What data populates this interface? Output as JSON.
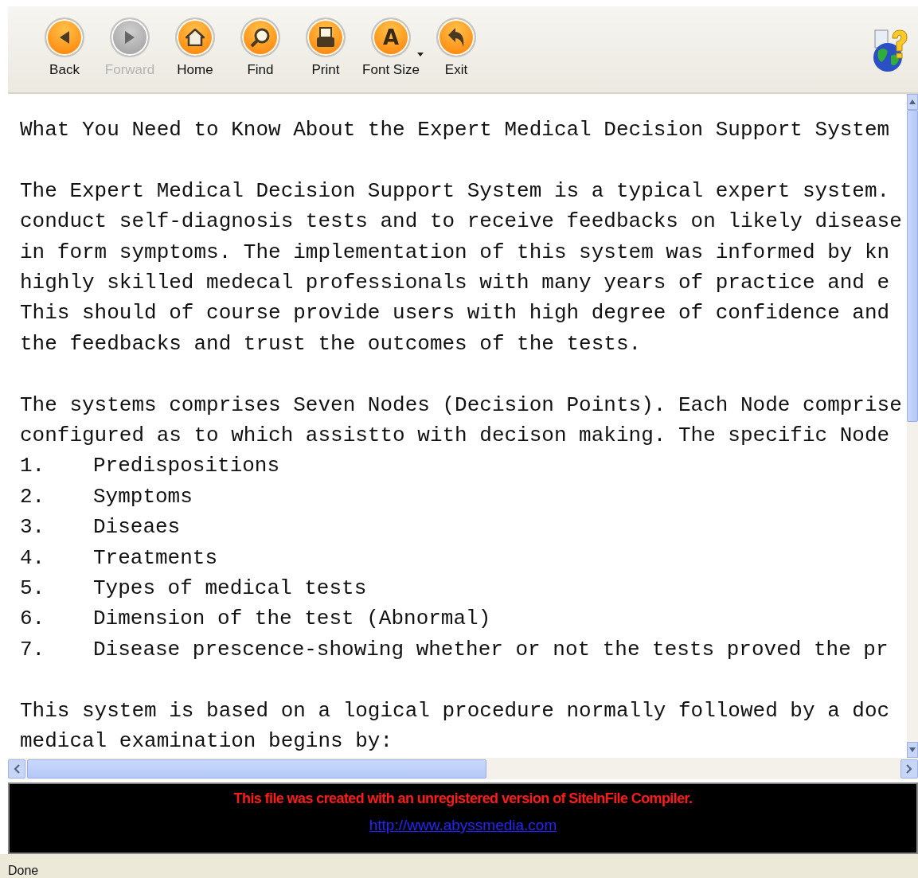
{
  "toolbar": {
    "buttons": [
      {
        "kind": "back",
        "label": "Back",
        "disabled": false
      },
      {
        "kind": "forward",
        "label": "Forward",
        "disabled": true
      },
      {
        "kind": "home",
        "label": "Home",
        "disabled": false
      },
      {
        "kind": "find",
        "label": "Find",
        "disabled": false
      },
      {
        "kind": "print",
        "label": "Print",
        "disabled": false
      },
      {
        "kind": "font",
        "label": "Font Size",
        "glyph": "A",
        "disabled": false,
        "dropdown": true
      },
      {
        "kind": "exit",
        "label": "Exit",
        "disabled": false
      }
    ]
  },
  "document": {
    "title": "What You Need to Know About the Expert Medical Decision Support System",
    "intro": [
      "The Expert Medical Decision Support System is a typical expert system.",
      "conduct self-diagnosis tests and to receive feedbacks on likely disease",
      "in form symptoms. The implementation of this system was informed by kn",
      "highly skilled medecal professionals with many years of practice and e",
      "This should of course provide users with high degree of confidence and",
      "the feedbacks and trust the outcomes of the tests."
    ],
    "nodes_intro": [
      "The systems comprises Seven Nodes (Decision Points). Each Node comprise",
      "configured as to which assistto with decison making. The specific Node"
    ],
    "nodes": [
      {
        "number": "1.",
        "text": "Predispositions"
      },
      {
        "number": "2.",
        "text": "Symptoms"
      },
      {
        "number": "3.",
        "text": "Diseaes"
      },
      {
        "number": "4.",
        "text": "Treatments"
      },
      {
        "number": "5.",
        "text": "Types of medical tests"
      },
      {
        "number": "6.",
        "text": "Dimension of the test (Abnormal)"
      },
      {
        "number": "7.",
        "text": "Disease prescence-showing whether or not the tests proved the pr"
      }
    ],
    "procedure": [
      "This system is based on a logical procedure normally followed by a doc",
      "medical examination begins by:"
    ]
  },
  "banner": {
    "notice": "This file was created with an unregistered version of SiteInFile Compiler.",
    "link": "http://www.abyssmedia.com"
  },
  "status_bar": {
    "text": "Done"
  }
}
